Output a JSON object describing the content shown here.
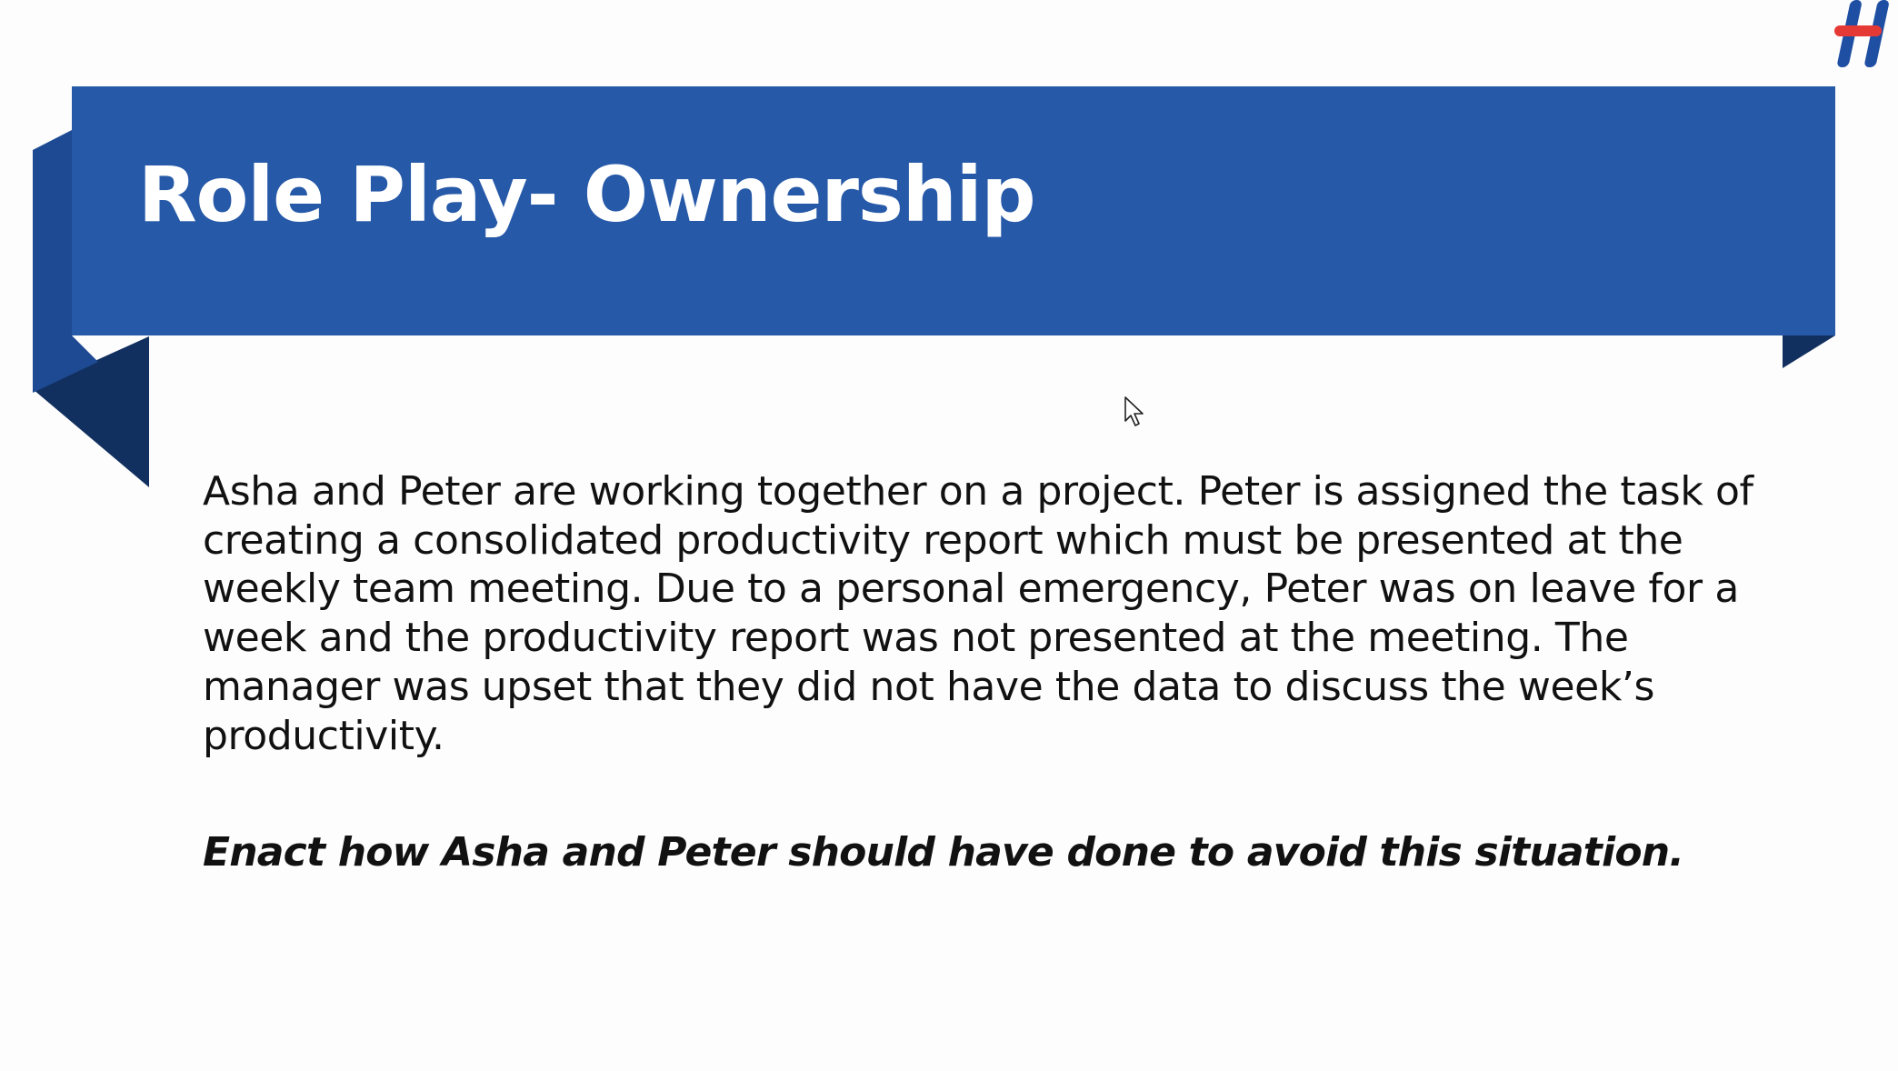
{
  "slide": {
    "title": "Role Play- Ownership",
    "scenario": "Asha and Peter are working together on a project. Peter is assigned the task of creating a consolidated productivity report which must be presented at the weekly team meeting. Due to a personal emergency, Peter was on leave for a week and the productivity report was not presented at the meeting. The manager was upset that they did not have the data to discuss the week’s productivity.",
    "task": "Enact how Asha and Peter should have done to avoid this situation."
  },
  "colors": {
    "banner": "#2659a8",
    "banner_fold_light": "#1e4a93",
    "banner_fold_dark": "#12305f",
    "logo_red": "#e53935",
    "logo_blue": "#1f4fa3"
  },
  "icons": {
    "logo": "brand-logo-icon",
    "cursor": "mouse-pointer-icon"
  }
}
